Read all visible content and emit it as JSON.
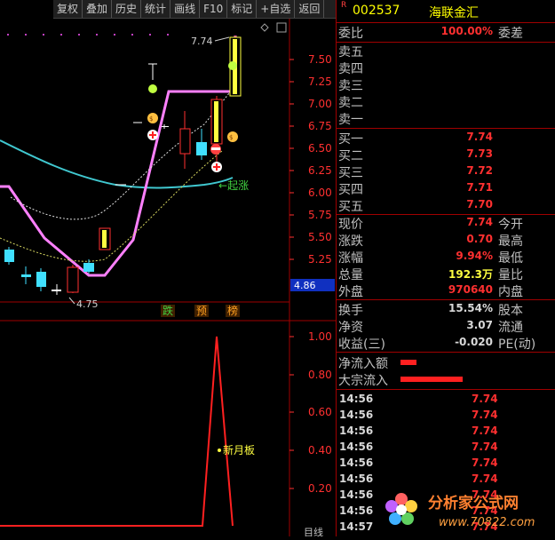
{
  "toolbar": {
    "buttons": [
      "复权",
      "叠加",
      "历史",
      "统计",
      "画线",
      "F10",
      "标记",
      "+自选",
      "返回"
    ]
  },
  "kchart": {
    "price_ticks": [
      "7.50",
      "7.25",
      "7.00",
      "6.75",
      "6.50",
      "6.25",
      "6.00",
      "5.75",
      "5.50",
      "5.25"
    ],
    "current_price_tag": "4.86",
    "high_label": "7.74",
    "low_label": "4.75",
    "qizhang_label": "起涨",
    "signal_labels": [
      "跌",
      "预",
      "榜"
    ]
  },
  "indicator": {
    "ticks": [
      "1.00",
      "0.80",
      "0.60",
      "0.40",
      "0.20"
    ],
    "marker_label": "新月板",
    "bottom_label": "目线"
  },
  "quote": {
    "badge": "R",
    "code": "002537",
    "name": "海联金汇",
    "weibi": {
      "label": "委比",
      "value": "100.00%",
      "label2": "委差"
    },
    "asks": [
      {
        "label": "卖五",
        "value": ""
      },
      {
        "label": "卖四",
        "value": ""
      },
      {
        "label": "卖三",
        "value": ""
      },
      {
        "label": "卖二",
        "value": ""
      },
      {
        "label": "卖一",
        "value": ""
      }
    ],
    "bids": [
      {
        "label": "买一",
        "value": "7.74"
      },
      {
        "label": "买二",
        "value": "7.73"
      },
      {
        "label": "买三",
        "value": "7.72"
      },
      {
        "label": "买四",
        "value": "7.71"
      },
      {
        "label": "买五",
        "value": "7.70"
      }
    ],
    "stats1": [
      {
        "label": "现价",
        "value": "7.74",
        "label2": "今开"
      },
      {
        "label": "涨跌",
        "value": "0.70",
        "label2": "最高"
      },
      {
        "label": "涨幅",
        "value": "9.94%",
        "label2": "最低"
      },
      {
        "label": "总量",
        "value": "192.3万",
        "label2": "量比"
      },
      {
        "label": "外盘",
        "value": "970640",
        "label2": "内盘"
      }
    ],
    "stats2": [
      {
        "label": "换手",
        "value": "15.54%",
        "label2": "股本"
      },
      {
        "label": "净资",
        "value": "3.07",
        "label2": "流通"
      },
      {
        "label": "收益(三)",
        "value": "-0.020",
        "label2": "PE(动)"
      }
    ],
    "flows": [
      {
        "label": "净流入额",
        "bar_fraction": 0.25
      },
      {
        "label": "大宗流入",
        "bar_fraction": 1.0
      }
    ],
    "ticks": [
      {
        "time": "14:56",
        "price": "7.74"
      },
      {
        "time": "14:56",
        "price": "7.74"
      },
      {
        "time": "14:56",
        "price": "7.74"
      },
      {
        "time": "14:56",
        "price": "7.74"
      },
      {
        "time": "14:56",
        "price": "7.74"
      },
      {
        "time": "14:56",
        "price": "7.74"
      },
      {
        "time": "14:56",
        "price": "7.74"
      },
      {
        "time": "14:56",
        "price": "7.74"
      },
      {
        "time": "14:57",
        "price": "7.74"
      }
    ]
  },
  "watermark": {
    "text": "分析家公式网",
    "url": "www.70822.com"
  }
}
